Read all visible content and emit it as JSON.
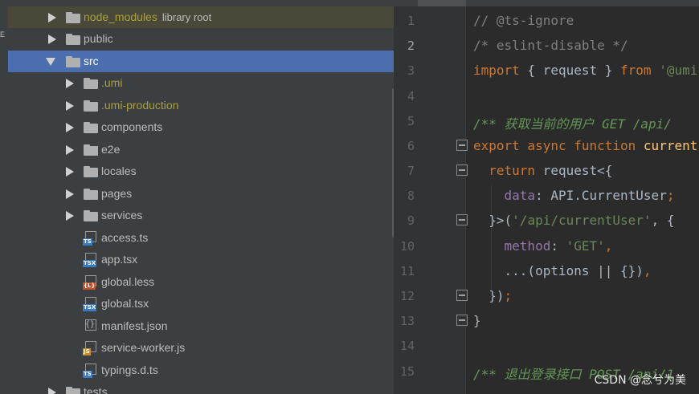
{
  "left_strip": {
    "glyph": "E"
  },
  "tree": {
    "rows": [
      {
        "name": "node_modules",
        "suffix": "library root"
      },
      {
        "name": "public"
      },
      {
        "name": "src"
      },
      {
        "name": ".umi"
      },
      {
        "name": ".umi-production"
      },
      {
        "name": "components"
      },
      {
        "name": "e2e"
      },
      {
        "name": "locales"
      },
      {
        "name": "pages"
      },
      {
        "name": "services"
      },
      {
        "name": "access.ts",
        "icon": "TS"
      },
      {
        "name": "app.tsx",
        "icon": "TSX"
      },
      {
        "name": "global.less",
        "icon": "{L}"
      },
      {
        "name": "global.tsx",
        "icon": "TSX"
      },
      {
        "name": "manifest.json",
        "icon": "{}"
      },
      {
        "name": "service-worker.js",
        "icon": "JS"
      },
      {
        "name": "typings.d.ts",
        "icon": "TS"
      },
      {
        "name": "tests"
      }
    ]
  },
  "editor": {
    "line_numbers": [
      "1",
      "2",
      "3",
      "4",
      "5",
      "6",
      "7",
      "8",
      "9",
      "10",
      "11",
      "12",
      "13",
      "14",
      "15"
    ],
    "lines": [
      {
        "t1": "// @ts-ignore"
      },
      {
        "t1": "/* eslint-disable */"
      },
      {
        "t1": "import",
        "t2": " { request } ",
        "t3": "from",
        "t4": " '@umi"
      },
      {
        "t1": ""
      },
      {
        "t1": "/** 获取当前的用户 GET /api/"
      },
      {
        "t1": "export async function ",
        "t2": "current"
      },
      {
        "t1": "  ",
        "t2": "return",
        "t3": " request<{"
      },
      {
        "t1": "    ",
        "t2": "data",
        "t3": ": API.CurrentUser",
        "t4": ";"
      },
      {
        "t1": "  }>(",
        "t2": "'/api/currentUser'",
        "t3": ", {"
      },
      {
        "t1": "    ",
        "t2": "method",
        "t3": ": ",
        "t4": "'GET'",
        "t5": ","
      },
      {
        "t1": "    ...(options || {})",
        "t2": ","
      },
      {
        "t1": "  })",
        "t2": ";"
      },
      {
        "t1": "}"
      },
      {
        "t1": ""
      },
      {
        "t1": "/** 退出登录接口 POST /api/1"
      }
    ]
  },
  "watermark": "CSDN @念兮为美"
}
